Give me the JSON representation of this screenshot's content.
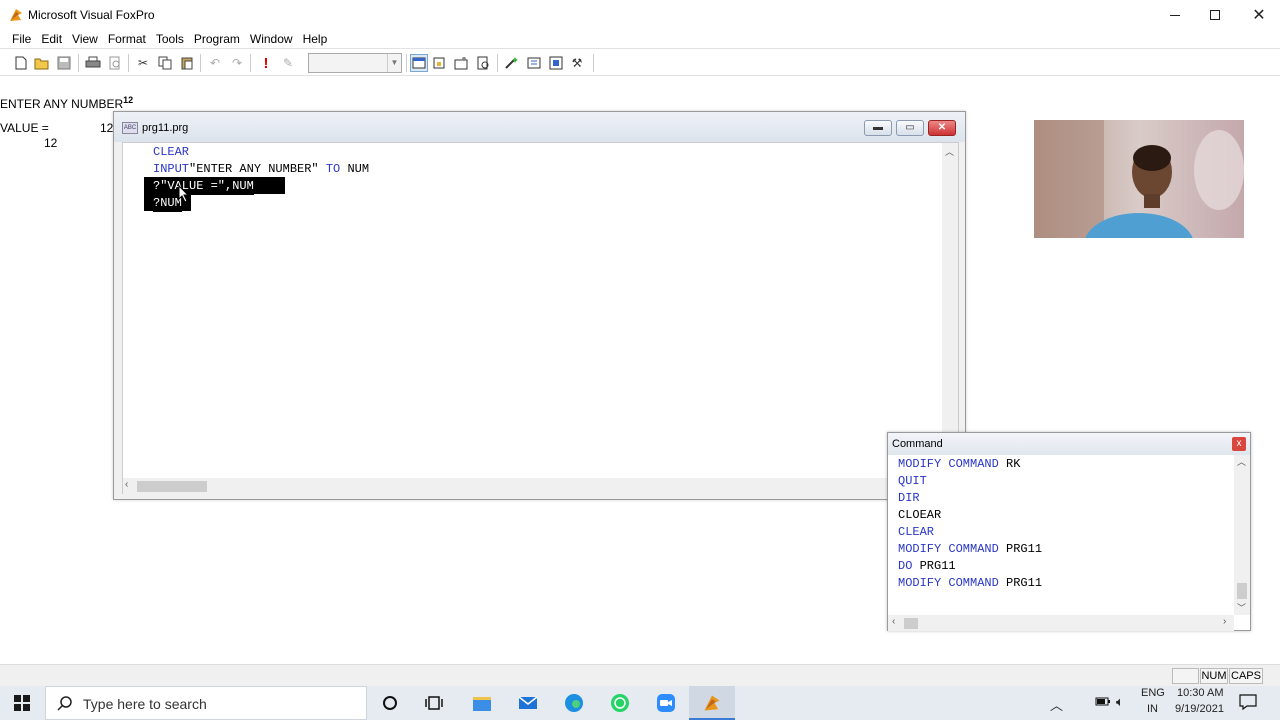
{
  "app": {
    "title": "Microsoft Visual FoxPro",
    "controls": [
      "—",
      "☐",
      "✕"
    ]
  },
  "menu": [
    "File",
    "Edit",
    "View",
    "Format",
    "Tools",
    "Program",
    "Window",
    "Help"
  ],
  "output": {
    "line1": "ENTER ANY NUMBER",
    "line1_value": "12",
    "line2_label": "VALUE =",
    "line2_value": "12",
    "line3_value": "12"
  },
  "editor": {
    "filename": "prg11.prg",
    "lines": [
      {
        "parts": [
          {
            "t": "CLEAR",
            "kw": true
          }
        ]
      },
      {
        "parts": [
          {
            "t": "INPUT",
            "kw": true
          },
          {
            "t": "\"ENTER ANY NUMBER\" ",
            "kw": false
          },
          {
            "t": "TO",
            "kw": true
          },
          {
            "t": " NUM",
            "kw": false
          }
        ]
      },
      {
        "text": "?\"VALUE =\",NUM"
      },
      {
        "text": "?NUM"
      }
    ]
  },
  "command": {
    "title": "Command",
    "close": "x",
    "lines": [
      {
        "kw": "MODIFY COMMAND",
        "arg": " RK"
      },
      {
        "kw": "QUIT",
        "arg": ""
      },
      {
        "kw": "DIR",
        "arg": ""
      },
      {
        "kw": "",
        "arg": "CLOEAR"
      },
      {
        "kw": "CLEAR",
        "arg": ""
      },
      {
        "kw": "MODIFY COMMAND",
        "arg": " PRG11"
      },
      {
        "kw": "DO",
        "arg": " PRG11"
      },
      {
        "kw": "MODIFY COMMAND",
        "arg": " PRG11"
      }
    ]
  },
  "status": {
    "num": "NUM",
    "caps": "CAPS"
  },
  "taskbar": {
    "search_placeholder": "Type here to search",
    "lang1": "ENG",
    "lang2": "IN",
    "time": "10:30 AM",
    "date": "9/19/2021"
  },
  "colors": {
    "keyword": "#2a36c7",
    "selection": "#000000"
  }
}
